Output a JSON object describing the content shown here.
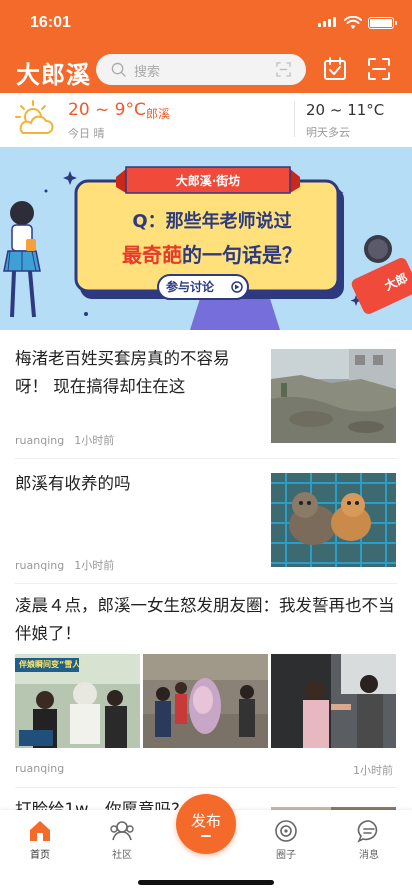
{
  "status": {
    "time": "16:01"
  },
  "header": {
    "logo": "大郎溪",
    "search_placeholder": "搜索",
    "icons": [
      "search-icon",
      "scan-icon",
      "calendar-check-icon",
      "scan-frame-icon"
    ],
    "accent": "#f46a2b"
  },
  "weather": {
    "today_temp": "20 ~ 9°C",
    "city": "郎溪",
    "today_desc": "今日 晴",
    "tomorrow_temp": "20 ~ 11°C",
    "tomorrow_desc": "明天多云"
  },
  "banner": {
    "tag": "大郎溪·街坊",
    "question_line1": "Q：那些年老师说过",
    "question_line2_highlight": "最奇葩",
    "question_line2_rest": "的一句话是？",
    "cta": "参与讨论",
    "mic_text": "大郎"
  },
  "feed": [
    {
      "title": "梅渚老百姓买套房真的不容易呀！ 现在搞得却住在这",
      "author": "ruanqing",
      "time": "1小时前"
    },
    {
      "title": "郎溪有收养的吗",
      "author": "ruanqing",
      "time": "1小时前"
    },
    {
      "title": "凌晨４点，郎溪一女生怒发朋友圈：我发誓再也不当伴娘了！",
      "author": "ruanqing",
      "time": "1小时前",
      "image_caption": "伴娘瞬间变“雪人”"
    },
    {
      "title": "打脸给1w，你愿意吗?"
    }
  ],
  "tabbar": {
    "home": "首页",
    "community": "社区",
    "publish": "发布",
    "circle": "圈子",
    "messages": "消息"
  }
}
